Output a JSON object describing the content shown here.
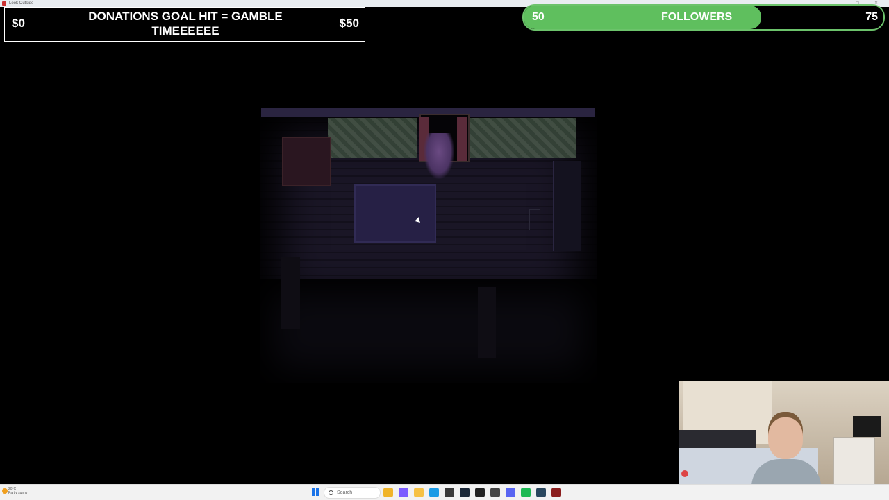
{
  "window": {
    "title": "Look Outside"
  },
  "donation_overlay": {
    "current_amount": "$0",
    "goal_text": "DONATIONS GOAL HIT = GAMBLE TIMEEEEEE",
    "goal_amount": "$50"
  },
  "follower_overlay": {
    "current": "50",
    "label": "FOLLOWERS",
    "goal": "75",
    "progress_fraction": 0.66,
    "fill_color": "#5fbf5e"
  },
  "taskbar": {
    "weather_temp": "20°C",
    "weather_desc": "Partly sunny",
    "search_placeholder": "Search",
    "apps": [
      "file-explorer-icon",
      "copilot-icon",
      "folder-icon",
      "edge-icon",
      "store-icon",
      "steam-icon",
      "capcut-icon",
      "terminal-icon",
      "discord-icon",
      "spotify-icon",
      "steam-alt-icon",
      "game-icon"
    ]
  }
}
